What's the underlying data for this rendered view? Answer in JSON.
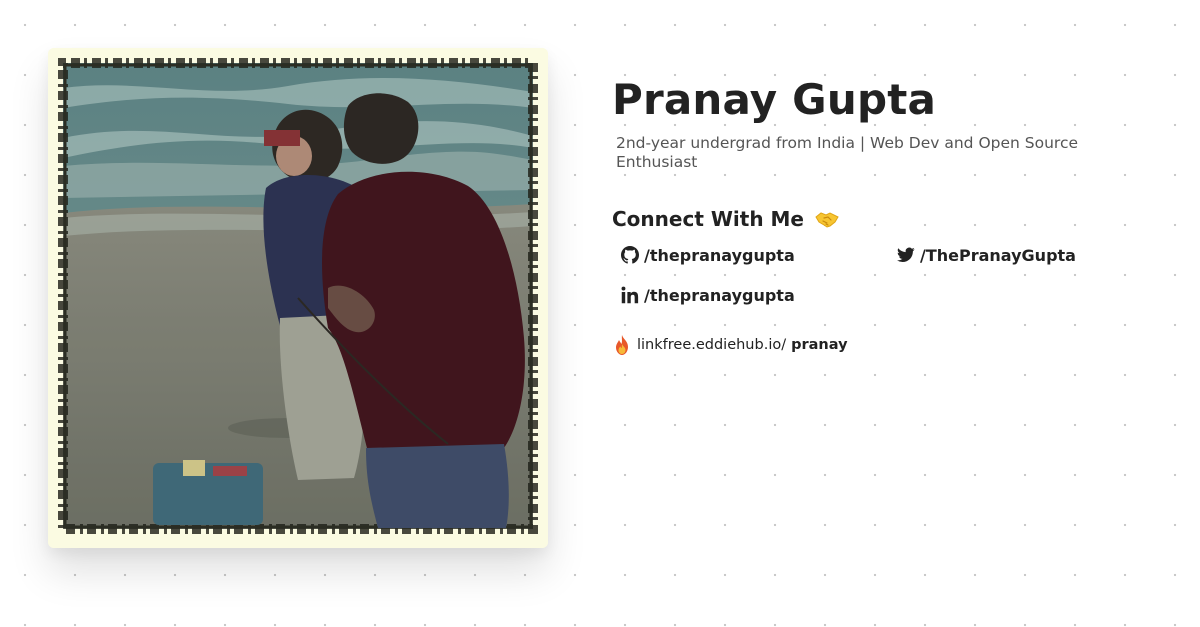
{
  "profile": {
    "name": "Pranay Gupta",
    "tagline": "2nd-year undergrad from India | Web Dev and Open Source Enthusiast"
  },
  "connect": {
    "heading": "Connect With Me",
    "heading_emoji": "handshake-emoji"
  },
  "socials": [
    {
      "platform": "github",
      "icon": "github-icon",
      "handle": "/thepranaygupta"
    },
    {
      "platform": "twitter",
      "icon": "twitter-icon",
      "handle": "/ThePranayGupta"
    },
    {
      "platform": "linkedin",
      "icon": "linkedin-icon",
      "handle": "/thepranaygupta"
    }
  ],
  "linkfree": {
    "icon": "linkfree-flame-icon",
    "url_prefix": "linkfree.eddiehub.io/",
    "username": "pranay"
  },
  "photo": {
    "alt": "profile-photo",
    "frame_color": "#fbfbe2"
  },
  "colors": {
    "text": "#222222",
    "muted": "#555555",
    "background": "#ffffff",
    "dot_grid": "#c9c9c9"
  }
}
